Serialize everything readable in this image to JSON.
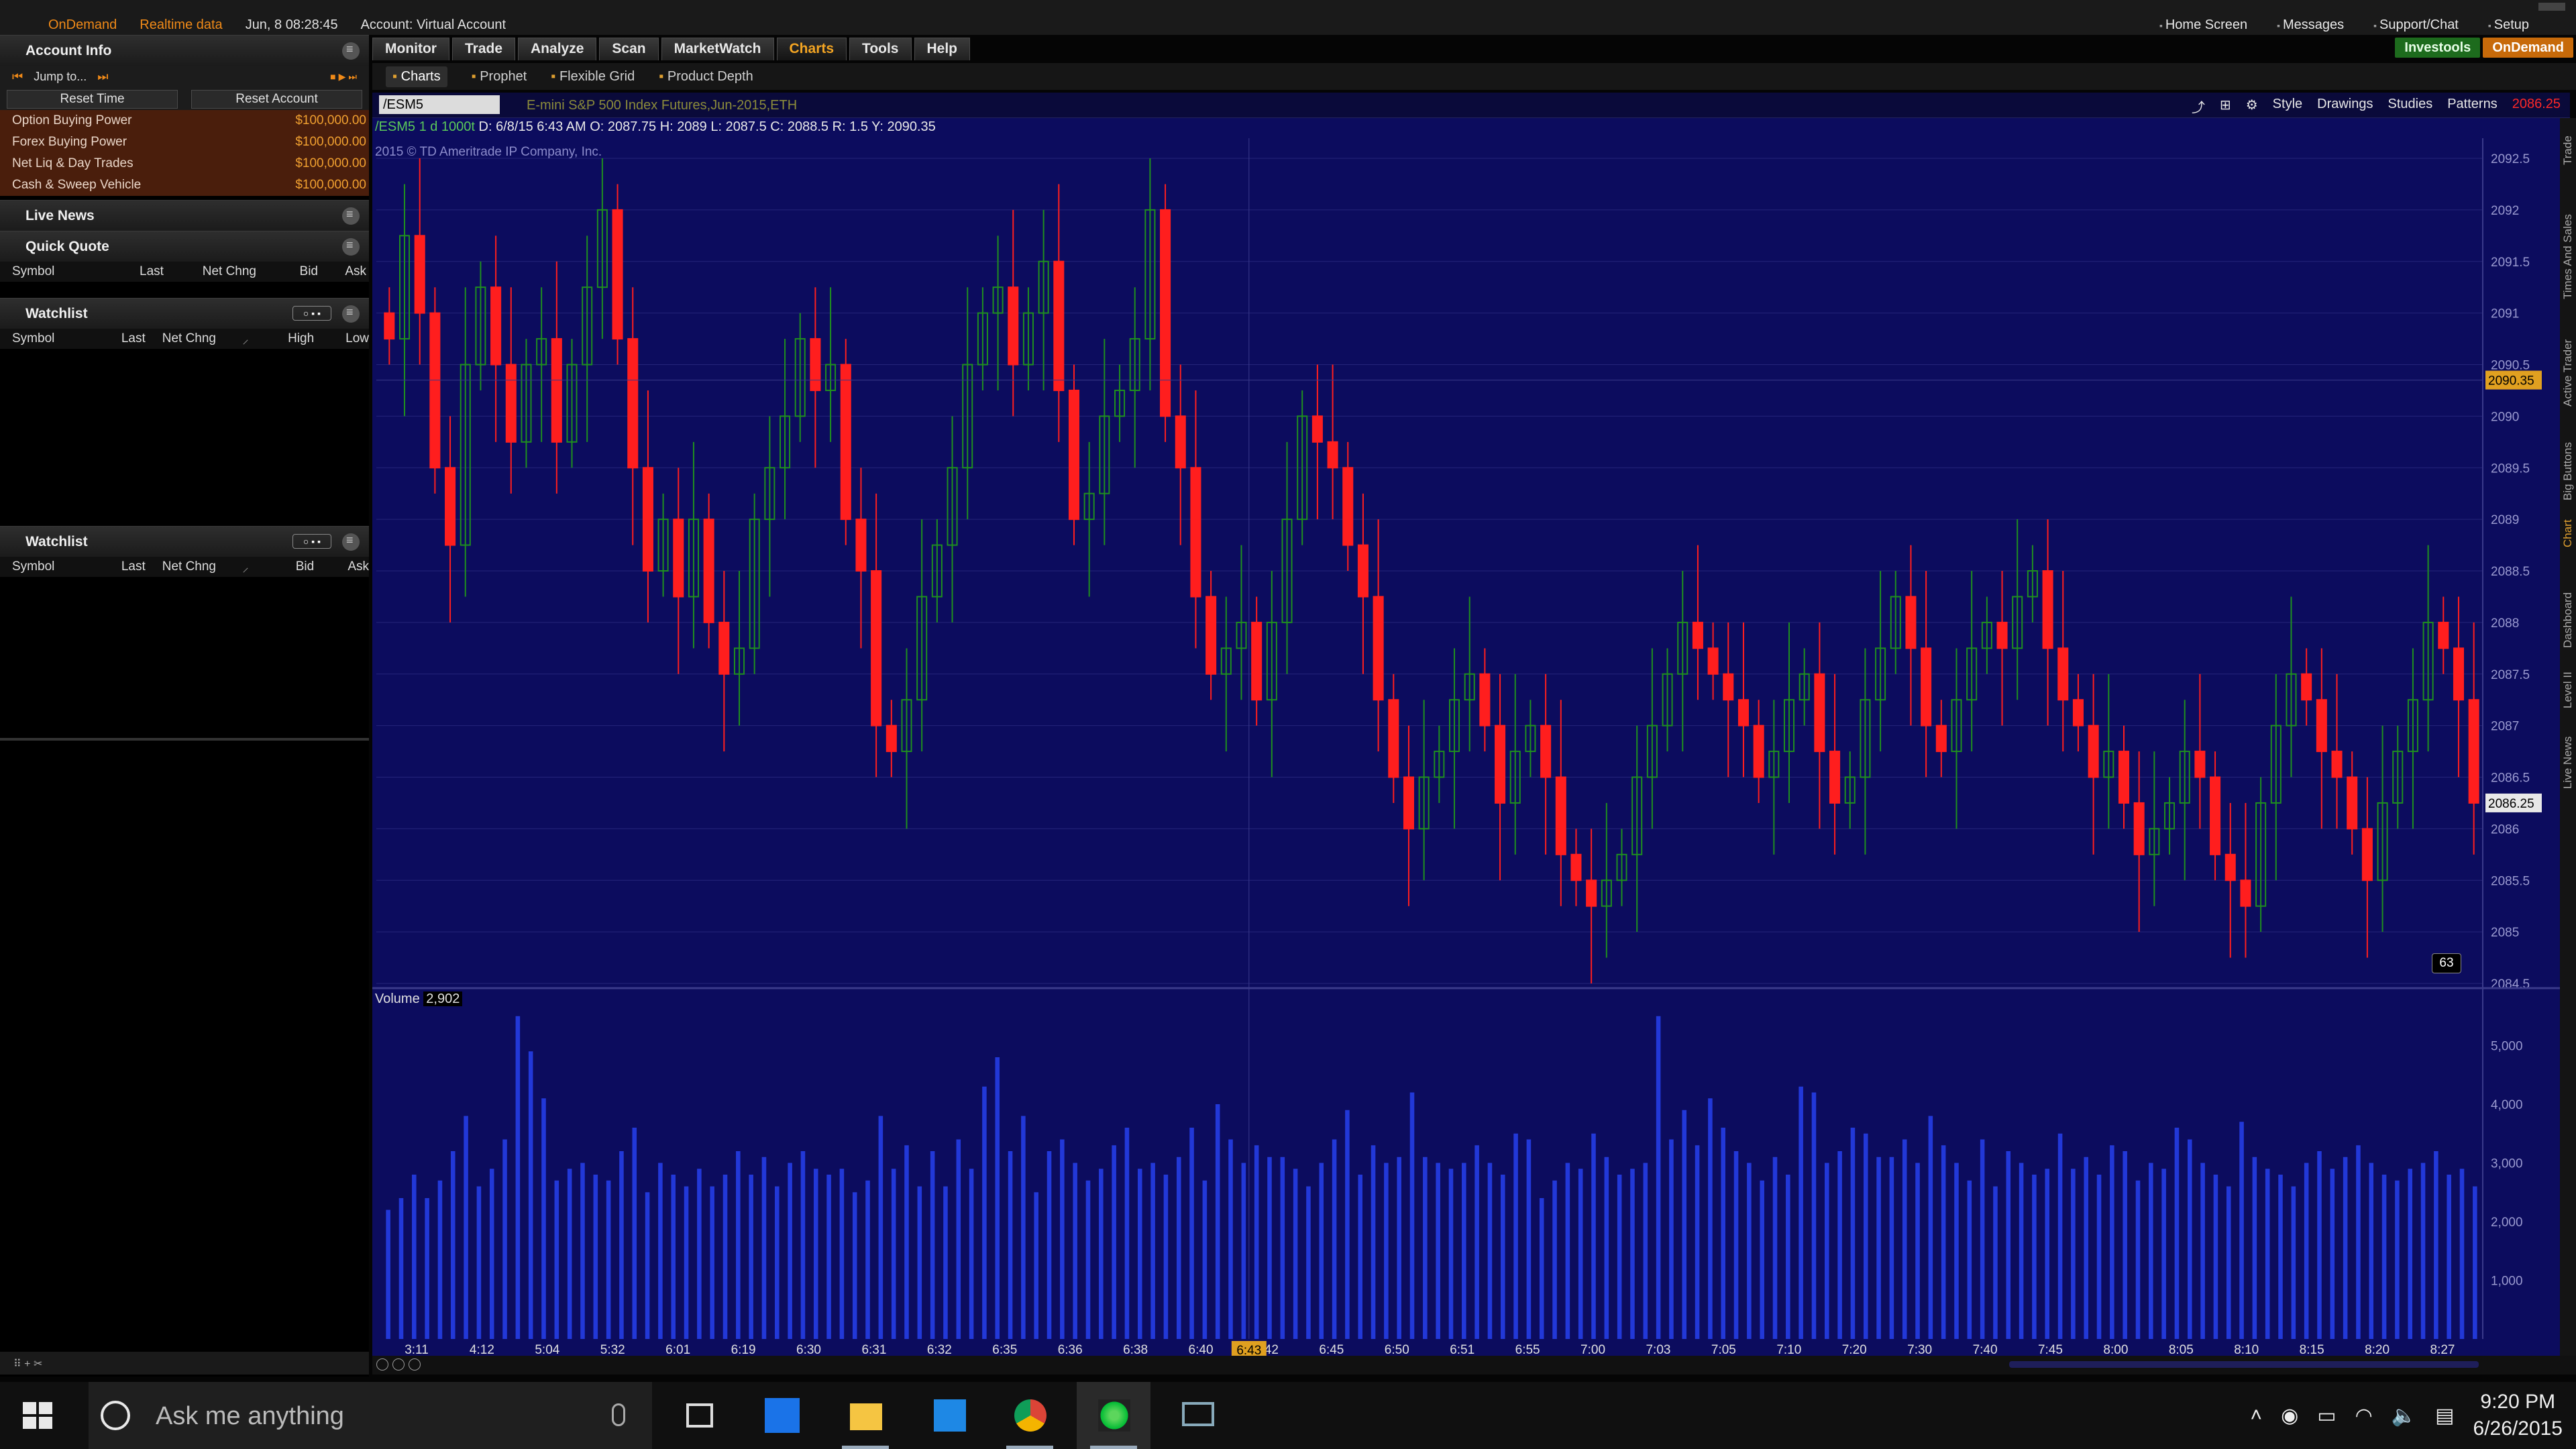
{
  "topbar": {
    "ondemand": "OnDemand",
    "realtime": "Realtime data",
    "datetime": "Jun, 8  08:28:45",
    "account": "Account: Virtual Account",
    "home_screen": "Home Screen",
    "messages": "Messages",
    "support_chat": "Support/Chat",
    "setup": "Setup"
  },
  "tabs": [
    "Monitor",
    "Trade",
    "Analyze",
    "Scan",
    "MarketWatch",
    "Charts",
    "Tools",
    "Help"
  ],
  "active_tab": "Charts",
  "brand": {
    "investools": "Investools",
    "ondemand": "OnDemand"
  },
  "subtabs": [
    "Charts",
    "Prophet",
    "Flexible Grid",
    "Product Depth"
  ],
  "left": {
    "account_info": {
      "title": "Account Info",
      "jump_to": "Jump to...",
      "reset_time": "Reset Time",
      "reset_account": "Reset Account",
      "rows": [
        {
          "label": "Option Buying Power",
          "value": "$100,000.00"
        },
        {
          "label": "Forex Buying Power",
          "value": "$100,000.00"
        },
        {
          "label": "Net Liq & Day Trades",
          "value": "$100,000.00"
        },
        {
          "label": "Cash & Sweep Vehicle",
          "value": "$100,000.00"
        }
      ]
    },
    "live_news": {
      "title": "Live News"
    },
    "quick_quote": {
      "title": "Quick Quote",
      "cols": [
        "Symbol",
        "Last",
        "Net Chng",
        "Bid",
        "Ask"
      ]
    },
    "watchlist1": {
      "title": "Watchlist",
      "cols": [
        "Symbol",
        "Last",
        "Net Chng",
        "High",
        "Low"
      ]
    },
    "watchlist2": {
      "title": "Watchlist",
      "cols": [
        "Symbol",
        "Last",
        "Net Chng",
        "Bid",
        "Ask"
      ]
    }
  },
  "chart_toolbar": {
    "symbol": "/ESM5",
    "description": "E-mini S&P 500 Index Futures,Jun-2015,ETH",
    "style": "Style",
    "drawings": "Drawings",
    "studies": "Studies",
    "patterns": "Patterns",
    "last_price": "2086.25"
  },
  "chart_header": {
    "symbol_period": "/ESM5 1 d 1000t",
    "ohlc": "D: 6/8/15 6:43 AM  O: 2087.75  H: 2089  L: 2087.5  C: 2088.5  R: 1.5  Y: 2090.35",
    "copyright": "2015 © TD Ameritrade IP Company, Inc.",
    "volume_label": "Volume",
    "volume_value": "2,902",
    "bar_count": "63",
    "price_marker_1": "2090.35",
    "price_marker_2": "2086.25",
    "cursor_time": "6:43"
  },
  "right_strip": [
    "Trade",
    "Times And Sales",
    "Active Trader",
    "Big Buttons",
    "Chart",
    "Dashboard",
    "Level II",
    "Live News"
  ],
  "taskbar": {
    "search_placeholder": "Ask me anything",
    "time": "9:20 PM",
    "date": "6/26/2015"
  },
  "colors": {
    "chart_bg": "#0c0c5e",
    "up": "#1f8f1f",
    "down": "#ff1e1e",
    "volume": "#2238d8",
    "grid": "#24247a"
  },
  "chart_data": {
    "type": "candlestick",
    "symbol": "/ESM5",
    "price_axis": {
      "ylim": [
        2084.5,
        2092.5
      ],
      "ticks": [
        "2092.5",
        "2092",
        "2091.5",
        "2091",
        "2090.5",
        "2090",
        "2089.5",
        "2089",
        "2088.5",
        "2088",
        "2087.5",
        "2087",
        "2086.5",
        "2086",
        "2085.5",
        "2085",
        "2084.5"
      ]
    },
    "volume_axis": {
      "ylim": [
        0,
        5600
      ],
      "ticks": [
        "5,000",
        "4,000",
        "3,000",
        "2,000",
        "1,000"
      ]
    },
    "time_labels": [
      "3:11",
      "4:12",
      "5:04",
      "5:32",
      "6:01",
      "6:19",
      "6:30",
      "6:31",
      "6:32",
      "6:35",
      "6:36",
      "6:38",
      "6:40",
      "6:42",
      "6:45",
      "6:50",
      "6:51",
      "6:55",
      "7:00",
      "7:03",
      "7:05",
      "7:10",
      "7:20",
      "7:30",
      "7:40",
      "7:45",
      "8:00",
      "8:05",
      "8:10",
      "8:15",
      "8:20",
      "8:27"
    ],
    "close_seed": [
      2090.75,
      2091.75,
      2091,
      2089.5,
      2088.75,
      2090.5,
      2091.25,
      2090.5,
      2089.75,
      2090.5,
      2090.75,
      2089.75,
      2090.5,
      2091.25,
      2092,
      2090.75,
      2089.5,
      2088.5,
      2089,
      2088.25,
      2089,
      2088,
      2087.5,
      2087.75,
      2089,
      2089.5,
      2090,
      2090.75,
      2090.25,
      2090.5,
      2089,
      2088.5,
      2087,
      2086.75,
      2087.25,
      2088.25,
      2088.75,
      2089.5,
      2090.5,
      2091,
      2091.25,
      2090.5,
      2091,
      2091.5,
      2090.25,
      2089,
      2089.25,
      2090,
      2090.25,
      2090.75,
      2092,
      2090,
      2089.5,
      2088.25,
      2087.5,
      2087.75,
      2088,
      2087.25,
      2088,
      2089,
      2090,
      2089.75,
      2089.5,
      2088.75,
      2088.25,
      2087.25,
      2086.5,
      2086,
      2086.5,
      2086.75,
      2087.25,
      2087.5,
      2087,
      2086.25,
      2086.75,
      2087,
      2086.5,
      2085.75,
      2085.5,
      2085.25,
      2085.5,
      2085.75,
      2086.5,
      2087,
      2087.5,
      2088,
      2087.75,
      2087.5,
      2087.25,
      2087,
      2086.5,
      2086.75,
      2087.25,
      2087.5,
      2086.75,
      2086.25,
      2086.5,
      2087.25,
      2087.75,
      2088.25,
      2087.75,
      2087,
      2086.75,
      2087.25,
      2087.75,
      2088,
      2087.75,
      2088.25,
      2088.5,
      2087.75,
      2087.25,
      2087,
      2086.5,
      2086.75,
      2086.25,
      2085.75,
      2086,
      2086.25,
      2086.75,
      2086.5,
      2085.75,
      2085.5,
      2085.25,
      2086.25,
      2087,
      2087.5,
      2087.25,
      2086.75,
      2086.5,
      2086,
      2085.5,
      2086.25,
      2086.75,
      2087.25,
      2088,
      2087.75,
      2087.25,
      2086.25
    ],
    "volume_seed": [
      2200,
      2400,
      2800,
      2400,
      2700,
      3200,
      3800,
      2600,
      2900,
      3400,
      5500,
      4900,
      4100,
      2700,
      2900,
      3000,
      2800,
      2700,
      3200,
      3600,
      2500,
      3000,
      2800,
      2600,
      2900,
      2600,
      2800,
      3200,
      2800,
      3100,
      2600,
      3000,
      3200,
      2900,
      2800,
      2900,
      2500,
      2700,
      3800,
      2900,
      3300,
      2600,
      3200,
      2600,
      3400,
      2900,
      4300,
      4800,
      3200,
      3800,
      2500,
      3200,
      3400,
      3000,
      2700,
      2900,
      3300,
      3600,
      2900,
      3000,
      2800,
      3100,
      3600,
      2700,
      4000,
      3400,
      3000,
      3300,
      3100,
      3100,
      2900,
      2600,
      3000,
      3400,
      3900,
      2800,
      3300,
      3000,
      3100,
      4200,
      3100,
      3000,
      2900,
      3000,
      3300,
      3000,
      2800,
      3500,
      3400,
      2400,
      2700,
      3000,
      2900,
      3500,
      3100,
      2800,
      2900,
      3000,
      5500,
      3400,
      3900,
      3300,
      4100,
      3600,
      3200,
      3000,
      2700,
      3100,
      2800,
      4300,
      4200,
      3000,
      3200,
      3600,
      3500,
      3100,
      3100,
      3400,
      3000,
      3800,
      3300,
      3000,
      2700,
      3400,
      2600,
      3200,
      3000,
      2800,
      2900,
      3500,
      2900,
      3100,
      2800,
      3300,
      3200,
      2700,
      3000,
      2900,
      3600,
      3400,
      3000,
      2800,
      2600,
      3700,
      3100,
      2900,
      2800,
      2600,
      3000,
      3200,
      2900,
      3100,
      3300,
      3000,
      2800,
      2700,
      2900,
      3000,
      3200,
      2800,
      2900,
      2600
    ]
  }
}
